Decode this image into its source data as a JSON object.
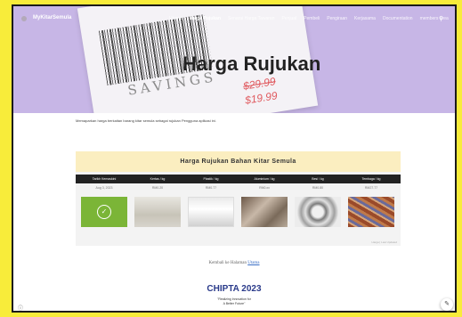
{
  "nav": {
    "brand": "MyKitarSemula",
    "links": [
      "Utama",
      "Harga Rujukan",
      "Senarai Harga Tawaran",
      "Penjual",
      "Pembeli",
      "Pengiraan",
      "Kerjasama",
      "Documentation",
      "members area"
    ],
    "active_index": 1,
    "search_icon": "search-icon"
  },
  "hero": {
    "title": "Harga Rujukan",
    "savings_text": "SAVINGS",
    "price_old": "$29.99",
    "price_new": "$19.99"
  },
  "intro": "Memaparkan harga berkaitan barang kitar semula sebagai rujukan Pengguna aplikasi ini.",
  "table": {
    "title": "Harga Rujukan Bahan Kitar Semula",
    "headers": [
      "Tarikh Kemaskini",
      "Kertas / kg",
      "Plastik / kg",
      "Aluminium / kg",
      "Besi / kg",
      "Tembaga / kg"
    ],
    "row": [
      "Aug 3, 2023",
      "RM0.20",
      "RM0.77",
      "RM0.xx",
      "RM0.80",
      "RM27.77"
    ],
    "footer": "Harga | Last Updated"
  },
  "back": {
    "prefix": "Kembali ke Halaman",
    "link": "Utama"
  },
  "sponsor": {
    "title": "CHIPTA 2023",
    "tagline_1": "\"Realizing Innovation for",
    "tagline_2": "A Better Future\""
  },
  "colors": {
    "background": "#f8ec3a",
    "hero": "#c7b6e6",
    "accent": "#7bb537"
  }
}
